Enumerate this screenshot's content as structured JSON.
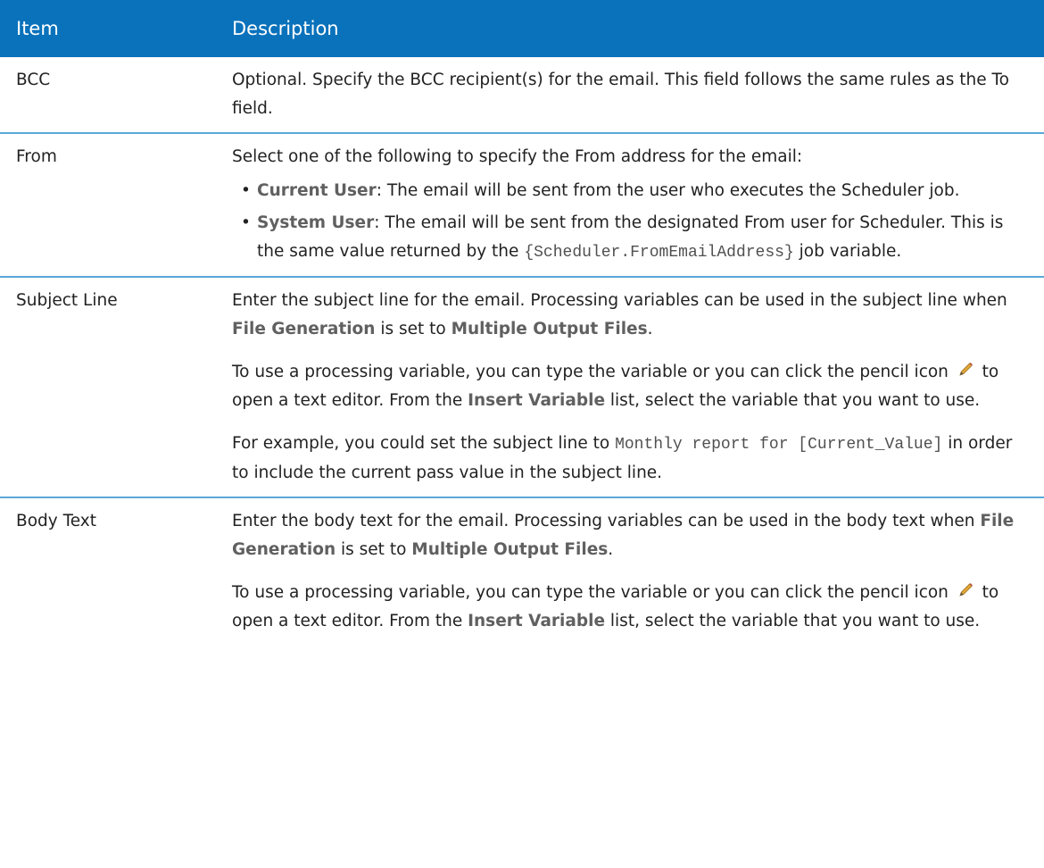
{
  "table": {
    "headers": {
      "item": "Item",
      "description": "Description"
    },
    "bcc": {
      "item": "BCC",
      "text": "Optional. Specify the BCC recipient(s) for the email. This field follows the same rules as the To field."
    },
    "from": {
      "item": "From",
      "intro": "Select one of the following to specify the From address for the email:",
      "options": [
        {
          "term": "Current User",
          "text": ": The email will be sent from the user who executes the Scheduler job."
        },
        {
          "term": "System User",
          "text": ": The email will be sent from the designated From user for Scheduler. This is the same value returned by the ",
          "code": "{Scheduler.FromEmailAddress}",
          "tail": " job variable."
        }
      ]
    },
    "subject_line": {
      "item": "Subject Line",
      "p1": {
        "a": "Enter the subject line for the email. Processing variables can be used in the subject line when ",
        "term1": "File Generation",
        "b": " is set to ",
        "term2": "Multiple Output Files",
        "c": "."
      },
      "p2": {
        "a": "To use a processing variable, you can type the variable or you can click the pencil icon ",
        "b": " to open a text editor. From the ",
        "term": "Insert Variable",
        "c": " list, select the variable that you want to use."
      },
      "p3": {
        "a": "For example, you could set the subject line to ",
        "code": "Monthly report for [Current_Value]",
        "b": " in order to include the current pass value in the subject line."
      }
    },
    "body_text": {
      "item": "Body Text",
      "p1": {
        "a": "Enter the body text for the email. Processing variables can be used in the body text when ",
        "term1": "File Generation",
        "b": " is set to ",
        "term2": "Multiple Output Files",
        "c": "."
      },
      "p2": {
        "a": "To use a processing variable, you can type the variable or you can click the pencil icon ",
        "b": " to open a text editor. From the ",
        "term": "Insert Variable",
        "c": " list, select the variable that you want to use."
      }
    }
  },
  "icons": {
    "bullet": "•",
    "pencil": "pencil-icon"
  },
  "colors": {
    "header_bg": "#0a72bb",
    "row_divider": "#5aa7d8",
    "ui_term": "#606060"
  }
}
